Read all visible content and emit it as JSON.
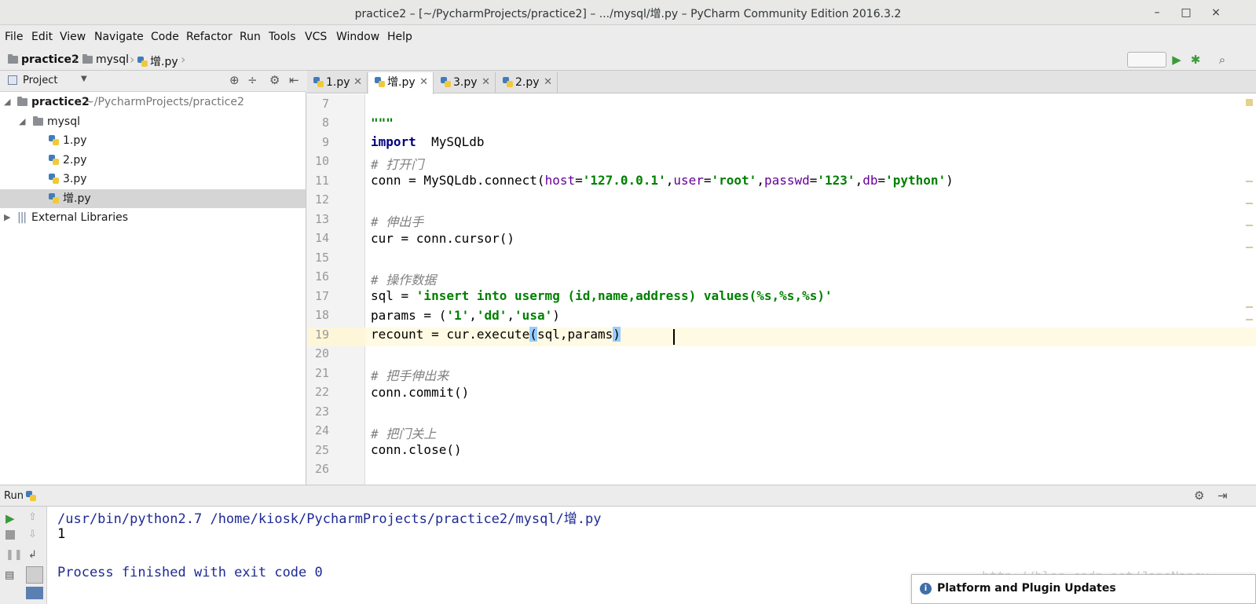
{
  "window": {
    "title": "practice2 – [~/PycharmProjects/practice2] – .../mysql/增.py – PyCharm Community Edition 2016.3.2",
    "minimize": "–",
    "maximize": "□",
    "close": "×"
  },
  "menu": [
    "File",
    "Edit",
    "View",
    "Navigate",
    "Code",
    "Refactor",
    "Run",
    "Tools",
    "VCS",
    "Window",
    "Help"
  ],
  "breadcrumb": [
    "practice2",
    "mysql",
    "增.py"
  ],
  "project_panel": {
    "title": "Project",
    "root": "practice2",
    "root_path": "~/PycharmProjects/practice2",
    "folder": "mysql",
    "files": [
      "1.py",
      "2.py",
      "3.py",
      "增.py"
    ],
    "external": "External Libraries"
  },
  "tabs": [
    {
      "label": "1.py",
      "active": false
    },
    {
      "label": "增.py",
      "active": true
    },
    {
      "label": "3.py",
      "active": false
    },
    {
      "label": "2.py",
      "active": false
    }
  ],
  "code": {
    "line_numbers": [
      "7",
      "8",
      "9",
      "10",
      "11",
      "12",
      "13",
      "14",
      "15",
      "16",
      "17",
      "18",
      "19",
      "20",
      "21",
      "22",
      "23",
      "24",
      "25",
      "26"
    ],
    "l8": "\"\"\"",
    "l9_kw": "import",
    "l9_rest": "  MySQLdb",
    "l10": "# 打开门",
    "l11_a": "conn = MySQLdb.connect(",
    "l11_k1": "host",
    "l11_v1": "'127.0.0.1'",
    "l11_k2": "user",
    "l11_v2": "'root'",
    "l11_k3": "passwd",
    "l11_v3": "'123'",
    "l11_k4": "db",
    "l11_v4": "'python'",
    "l13": "# 伸出手",
    "l14": "cur = conn.cursor()",
    "l16": "# 操作数据",
    "l17_a": "sql = ",
    "l17_s": "'insert into usermg (id,name,address) values(%s,%s,%s)'",
    "l18_a": "params = (",
    "l18_v1": "'1'",
    "l18_v2": "'dd'",
    "l18_v3": "'usa'",
    "l19_a": "recount = cur.execute",
    "l19_b": "sql,params",
    "l21": "# 把手伸出来",
    "l22": "conn.commit()",
    "l24": "# 把门关上",
    "l25": "conn.close()"
  },
  "run": {
    "label": "Run",
    "command": "/usr/bin/python2.7 /home/kiosk/PycharmProjects/practice2/mysql/增.py",
    "output": "1",
    "finished": "Process finished with exit code 0"
  },
  "notification": {
    "title": "Platform and Plugin Updates"
  },
  "watermark": "http://blog.csdn.net/JaneNancy",
  "colors": {
    "keyword": "#000080",
    "string": "#008000",
    "comment": "#808080",
    "kwarg": "#660099",
    "current_line": "#fffae3"
  }
}
